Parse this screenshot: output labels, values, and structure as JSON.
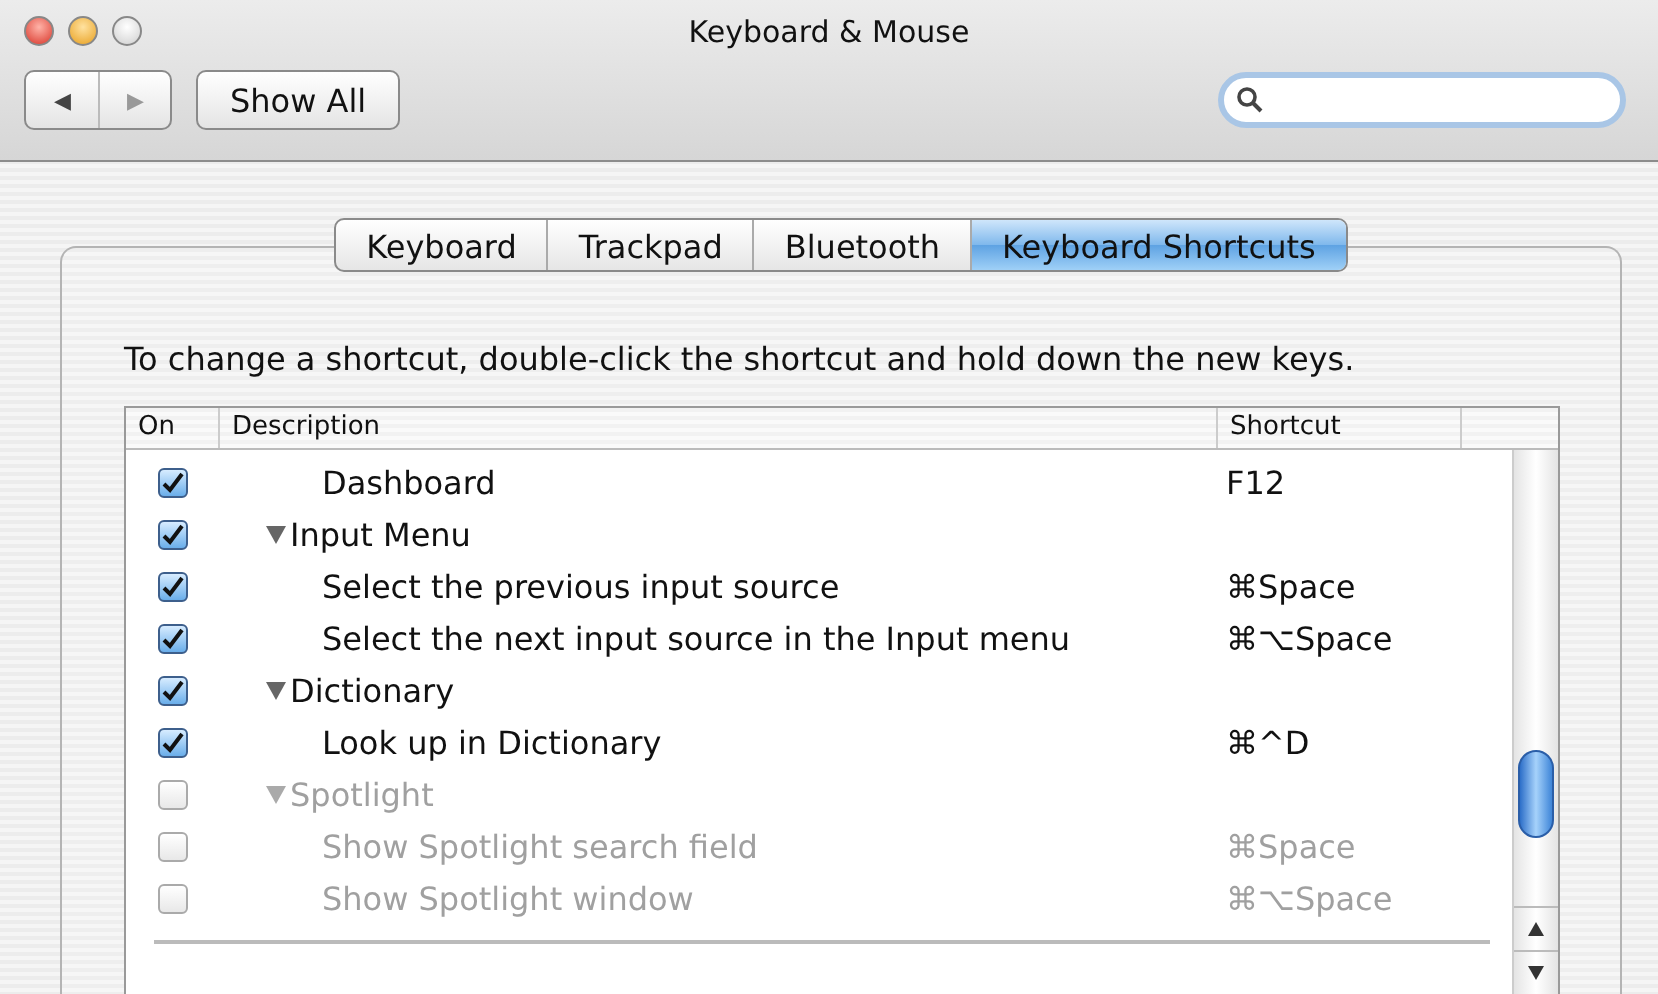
{
  "window": {
    "title": "Keyboard & Mouse"
  },
  "toolbar": {
    "back": "◀",
    "forward": "▶",
    "show_all": "Show All"
  },
  "tabs": [
    {
      "label": "Keyboard",
      "selected": false
    },
    {
      "label": "Trackpad",
      "selected": false
    },
    {
      "label": "Bluetooth",
      "selected": false
    },
    {
      "label": "Keyboard Shortcuts",
      "selected": true
    }
  ],
  "instructions": "To change a shortcut, double-click the shortcut and hold down the new keys.",
  "table": {
    "columns": [
      "On",
      "Description",
      "Shortcut"
    ],
    "rows": [
      {
        "kind": "item",
        "on": true,
        "description": "Dashboard",
        "shortcut": "F12"
      },
      {
        "kind": "group",
        "on": true,
        "description": "Input Menu",
        "expanded": true,
        "children": [
          {
            "kind": "item",
            "on": true,
            "description": "Select the previous input source",
            "shortcut": "⌘Space"
          },
          {
            "kind": "item",
            "on": true,
            "description": "Select the next input source in the Input menu",
            "shortcut": "⌘⌥Space"
          }
        ]
      },
      {
        "kind": "group",
        "on": true,
        "description": "Dictionary",
        "expanded": true,
        "children": [
          {
            "kind": "item",
            "on": true,
            "description": "Look up in Dictionary",
            "shortcut": "⌘^D"
          }
        ]
      },
      {
        "kind": "group",
        "on": false,
        "description": "Spotlight",
        "expanded": true,
        "children": [
          {
            "kind": "item",
            "on": false,
            "description": "Show Spotlight search field",
            "shortcut": "⌘Space"
          },
          {
            "kind": "item",
            "on": false,
            "description": "Show Spotlight window",
            "shortcut": "⌘⌥Space"
          }
        ]
      }
    ]
  }
}
